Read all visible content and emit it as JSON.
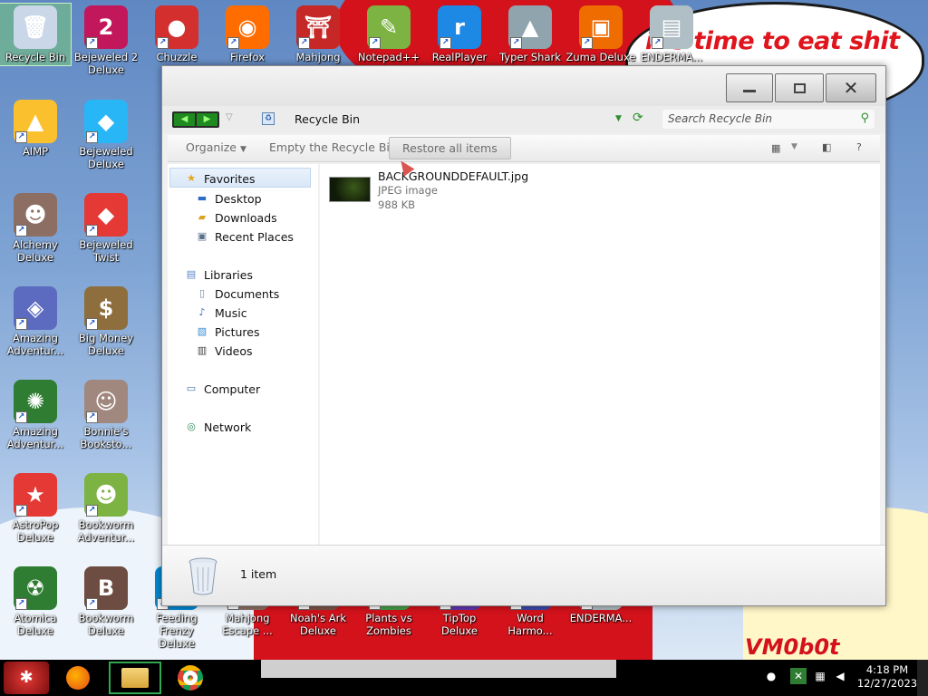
{
  "wallpaper": {
    "speech_text": "it's time to eat shit",
    "watermark": "VM0b0t"
  },
  "desktop_icons": [
    {
      "label": "Recycle Bin",
      "art": "recycle-bin-icon",
      "glyph": "🗑",
      "color": "#c9d7e8",
      "selected": true
    },
    {
      "label": "Bejeweled 2 Deluxe",
      "art": "bejeweled2-icon",
      "glyph": "2",
      "color": "#c2185b"
    },
    {
      "label": "Chuzzle",
      "art": "chuzzle-icon",
      "glyph": "●",
      "color": "#d32f2f"
    },
    {
      "label": "Firefox",
      "art": "firefox-icon",
      "glyph": "◉",
      "color": "#ff6d00"
    },
    {
      "label": "Mahjong",
      "art": "mahjong-icon",
      "glyph": "⛩",
      "color": "#c62828"
    },
    {
      "label": "Notepad++",
      "art": "notepad-plus-plus-icon",
      "glyph": "✎",
      "color": "#7cb342"
    },
    {
      "label": "RealPlayer",
      "art": "realplayer-icon",
      "glyph": "r",
      "color": "#1e88e5"
    },
    {
      "label": "Typer Shark",
      "art": "typer-shark-icon",
      "glyph": "▲",
      "color": "#90a4ae"
    },
    {
      "label": "Zuma Deluxe",
      "art": "zuma-icon",
      "glyph": "▣",
      "color": "#ef6c00"
    },
    {
      "label": "ENDERMA...",
      "art": "enderman-icon",
      "glyph": "▤",
      "color": "#b0bec5"
    },
    {
      "label": "AIMP",
      "art": "aimp-icon",
      "glyph": "▲",
      "color": "#fbc02d"
    },
    {
      "label": "Bejeweled Deluxe",
      "art": "bejeweled-icon",
      "glyph": "◆",
      "color": "#29b6f6"
    },
    {
      "label": "Alchemy Deluxe",
      "art": "alchemy-icon",
      "glyph": "☻",
      "color": "#8d6e63"
    },
    {
      "label": "Bejeweled Twist",
      "art": "bejeweled-twist-icon",
      "glyph": "◆",
      "color": "#e53935"
    },
    {
      "label": "Amazing Adventur...",
      "art": "amazing-adventures-icon",
      "glyph": "◈",
      "color": "#5c6bc0"
    },
    {
      "label": "Big Money Deluxe",
      "art": "big-money-icon",
      "glyph": "$",
      "color": "#8d6e3c"
    },
    {
      "label": "Amazing Adventur...",
      "art": "amazing-adventures-2-icon",
      "glyph": "✺",
      "color": "#2e7d32"
    },
    {
      "label": "Bonnie's Booksto...",
      "art": "bonnies-bookstore-icon",
      "glyph": "☺",
      "color": "#a1887f"
    },
    {
      "label": "AstroPop Deluxe",
      "art": "astropop-icon",
      "glyph": "★",
      "color": "#e53935"
    },
    {
      "label": "Bookworm Adventur...",
      "art": "bookworm-adventures-icon",
      "glyph": "☻",
      "color": "#7cb342"
    },
    {
      "label": "Atomica Deluxe",
      "art": "atomica-icon",
      "glyph": "☢",
      "color": "#2e7d32"
    },
    {
      "label": "Bookworm Deluxe",
      "art": "bookworm-icon",
      "glyph": "B",
      "color": "#6d4c41"
    },
    {
      "label": "Feeding Frenzy Deluxe",
      "art": "feeding-frenzy-icon",
      "glyph": "◐",
      "color": "#0288d1"
    },
    {
      "label": "Mahjong Escape ...",
      "art": "mahjong-escape-icon",
      "glyph": "▦",
      "color": "#8d6e63"
    },
    {
      "label": "Noah's Ark Deluxe",
      "art": "noahs-ark-icon",
      "glyph": "⛵",
      "color": "#795548"
    },
    {
      "label": "Plants vs Zombies",
      "art": "plants-vs-zombies-icon",
      "glyph": "✿",
      "color": "#43a047"
    },
    {
      "label": "TipTop Deluxe",
      "art": "tiptop-icon",
      "glyph": "◒",
      "color": "#5e35b1"
    },
    {
      "label": "Word Harmo...",
      "art": "word-harmony-icon",
      "glyph": "W",
      "color": "#3949ab"
    },
    {
      "label": "ENDERMA...",
      "art": "enderman-2-icon",
      "glyph": "▤",
      "color": "#b0bec5"
    }
  ],
  "explorer": {
    "breadcrumb": "Recycle Bin",
    "search_placeholder": "Search Recycle Bin",
    "toolbar": {
      "organize": "Organize",
      "empty": "Empty the Recycle Bin",
      "restore": "Restore all items",
      "help": "?"
    },
    "nav": {
      "favorites": "Favorites",
      "desktop": "Desktop",
      "downloads": "Downloads",
      "recent": "Recent Places",
      "libraries": "Libraries",
      "documents": "Documents",
      "music": "Music",
      "pictures": "Pictures",
      "videos": "Videos",
      "computer": "Computer",
      "network": "Network"
    },
    "file": {
      "name": "BACKGROUNDDEFAULT.jpg",
      "type": "JPEG image",
      "size": "988 KB"
    },
    "status": "1 item"
  },
  "taskbar": {
    "time": "4:18 PM",
    "date": "12/27/2023"
  }
}
